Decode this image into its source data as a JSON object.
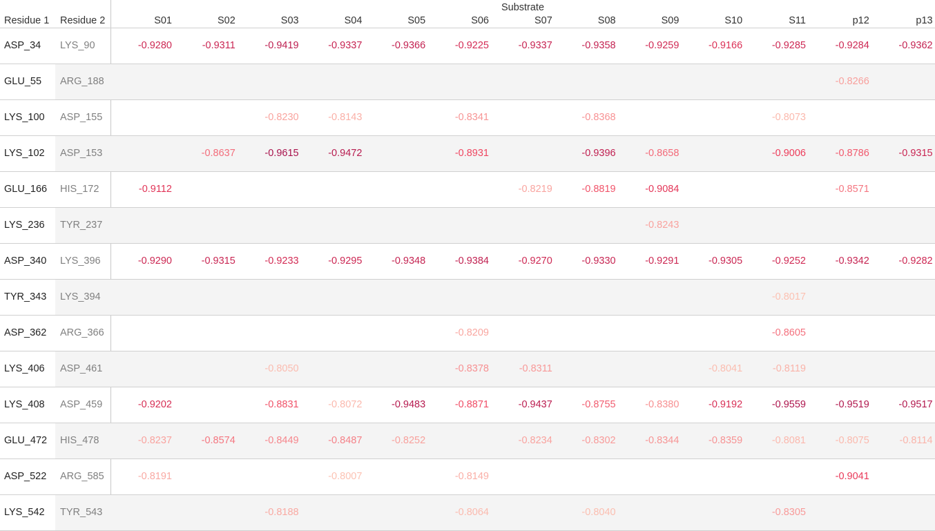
{
  "chart_data": {
    "type": "table",
    "column_group_title": "Substrate",
    "row_headers": [
      "Residue 1",
      "Residue 2"
    ],
    "columns": [
      "S01",
      "S02",
      "S03",
      "S04",
      "S05",
      "S06",
      "S07",
      "S08",
      "S09",
      "S10",
      "S11",
      "p12",
      "p13"
    ],
    "rows": [
      {
        "residue1": "ASP_34",
        "residue2": "LYS_90",
        "values": [
          "-0.9280",
          "-0.9311",
          "-0.9419",
          "-0.9337",
          "-0.9366",
          "-0.9225",
          "-0.9337",
          "-0.9358",
          "-0.9259",
          "-0.9166",
          "-0.9285",
          "-0.9284",
          "-0.9362"
        ]
      },
      {
        "residue1": "GLU_55",
        "residue2": "ARG_188",
        "values": [
          null,
          null,
          null,
          null,
          null,
          null,
          null,
          null,
          null,
          null,
          null,
          "-0.8266",
          null
        ]
      },
      {
        "residue1": "LYS_100",
        "residue2": "ASP_155",
        "values": [
          null,
          null,
          "-0.8230",
          "-0.8143",
          null,
          "-0.8341",
          null,
          "-0.8368",
          null,
          null,
          "-0.8073",
          null,
          null
        ]
      },
      {
        "residue1": "LYS_102",
        "residue2": "ASP_153",
        "values": [
          null,
          "-0.8637",
          "-0.9615",
          "-0.9472",
          null,
          "-0.8931",
          null,
          "-0.9396",
          "-0.8658",
          null,
          "-0.9006",
          "-0.8786",
          "-0.9315"
        ]
      },
      {
        "residue1": "GLU_166",
        "residue2": "HIS_172",
        "values": [
          "-0.9112",
          null,
          null,
          null,
          null,
          null,
          "-0.8219",
          "-0.8819",
          "-0.9084",
          null,
          null,
          "-0.8571",
          null
        ]
      },
      {
        "residue1": "LYS_236",
        "residue2": "TYR_237",
        "values": [
          null,
          null,
          null,
          null,
          null,
          null,
          null,
          null,
          "-0.8243",
          null,
          null,
          null,
          null
        ]
      },
      {
        "residue1": "ASP_340",
        "residue2": "LYS_396",
        "values": [
          "-0.9290",
          "-0.9315",
          "-0.9233",
          "-0.9295",
          "-0.9348",
          "-0.9384",
          "-0.9270",
          "-0.9330",
          "-0.9291",
          "-0.9305",
          "-0.9252",
          "-0.9342",
          "-0.9282"
        ]
      },
      {
        "residue1": "TYR_343",
        "residue2": "LYS_394",
        "values": [
          null,
          null,
          null,
          null,
          null,
          null,
          null,
          null,
          null,
          null,
          "-0.8017",
          null,
          null
        ]
      },
      {
        "residue1": "ASP_362",
        "residue2": "ARG_366",
        "values": [
          null,
          null,
          null,
          null,
          null,
          "-0.8209",
          null,
          null,
          null,
          null,
          "-0.8605",
          null,
          null
        ]
      },
      {
        "residue1": "LYS_406",
        "residue2": "ASP_461",
        "values": [
          null,
          null,
          "-0.8050",
          null,
          null,
          "-0.8378",
          "-0.8311",
          null,
          null,
          "-0.8041",
          "-0.8119",
          null,
          null
        ]
      },
      {
        "residue1": "LYS_408",
        "residue2": "ASP_459",
        "values": [
          "-0.9202",
          null,
          "-0.8831",
          "-0.8072",
          "-0.9483",
          "-0.8871",
          "-0.9437",
          "-0.8755",
          "-0.8380",
          "-0.9192",
          "-0.9559",
          "-0.9519",
          "-0.9517"
        ]
      },
      {
        "residue1": "GLU_472",
        "residue2": "HIS_478",
        "values": [
          "-0.8237",
          "-0.8574",
          "-0.8449",
          "-0.8487",
          "-0.8252",
          null,
          "-0.8234",
          "-0.8302",
          "-0.8344",
          "-0.8359",
          "-0.8081",
          "-0.8075",
          "-0.8114"
        ]
      },
      {
        "residue1": "ASP_522",
        "residue2": "ARG_585",
        "values": [
          "-0.8191",
          null,
          null,
          "-0.8007",
          null,
          "-0.8149",
          null,
          null,
          null,
          null,
          null,
          "-0.9041",
          null
        ]
      },
      {
        "residue1": "LYS_542",
        "residue2": "TYR_543",
        "values": [
          null,
          null,
          "-0.8188",
          null,
          null,
          "-0.8064",
          null,
          "-0.8040",
          null,
          null,
          "-0.8305",
          null,
          null
        ]
      }
    ],
    "color_scale": {
      "stops": [
        {
          "value": -0.8,
          "color": "#fcc3b4"
        },
        {
          "value": -0.9,
          "color": "#ee3c5a"
        },
        {
          "value": -0.96,
          "color": "#a8124c"
        }
      ]
    },
    "band_color": "#f4f4f4"
  }
}
